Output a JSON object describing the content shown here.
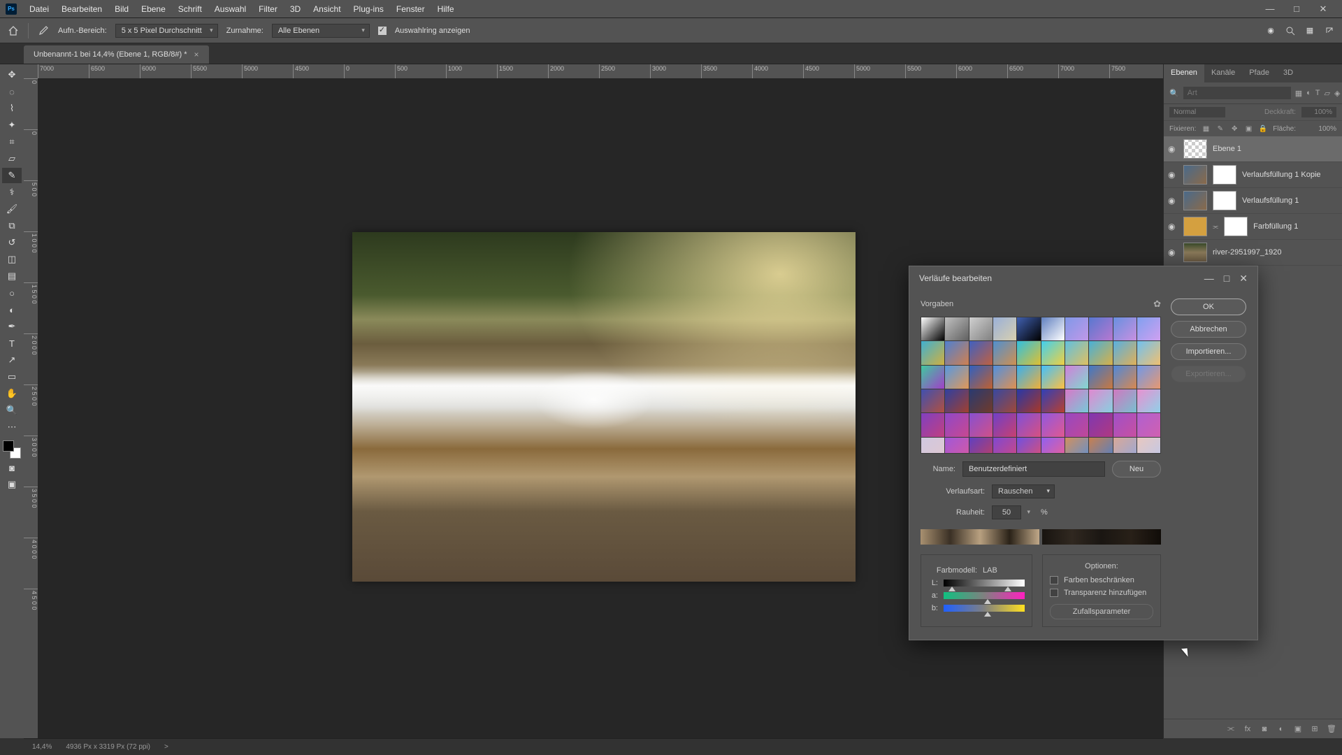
{
  "app_logo": "Ps",
  "menubar": [
    "Datei",
    "Bearbeiten",
    "Bild",
    "Ebene",
    "Schrift",
    "Auswahl",
    "Filter",
    "3D",
    "Ansicht",
    "Plug-ins",
    "Fenster",
    "Hilfe"
  ],
  "optbar": {
    "sample_label": "Aufn.-Bereich:",
    "sample_value": "5 x 5 Pixel Durchschnitt",
    "layers_label": "Zurnahme:",
    "layers_value": "Alle Ebenen",
    "checkbox_label": "Auswahlring anzeigen"
  },
  "tab": {
    "title": "Unbenannt-1 bei 14,4% (Ebene 1, RGB/8#) *",
    "close": "×"
  },
  "ruler_h": [
    "7000",
    "6500",
    "6000",
    "5500",
    "5000",
    "4500",
    "0",
    "500",
    "1000",
    "1500",
    "2000",
    "2500",
    "3000",
    "3500",
    "4000",
    "4500",
    "5000",
    "5500",
    "6000",
    "6500",
    "7000",
    "7500"
  ],
  "ruler_v": [
    "0",
    "0",
    "5 0 0",
    "1 0 0 0",
    "1 5 0 0",
    "2 0 0 0",
    "2 5 0 0",
    "3 0 0 0",
    "3 5 0 0",
    "4 0 0 0",
    "4 5 0 0"
  ],
  "panels": {
    "tabs": [
      "Ebenen",
      "Kanäle",
      "Pfade",
      "3D"
    ],
    "search_placeholder": "Art",
    "blend_mode": "Normal",
    "opacity_label": "Deckkraft:",
    "opacity_value": "100%",
    "lock_label": "Fixieren:",
    "fill_label": "Fläche:",
    "fill_value": "100%"
  },
  "layers": [
    {
      "name": "Ebene 1",
      "thumb": "checker",
      "selected": true
    },
    {
      "name": "Verlaufsfüllung 1 Kopie",
      "thumb": "grad",
      "mask": true
    },
    {
      "name": "Verlaufsfüllung 1",
      "thumb": "grad",
      "mask": true
    },
    {
      "name": "Farbfüllung 1",
      "thumb": "solid",
      "mask": true,
      "linked": true
    },
    {
      "name": "river-2951997_1920",
      "thumb": "img"
    }
  ],
  "statusbar": {
    "zoom": "14,4%",
    "docinfo": "4936 Px x 3319 Px (72 ppi)",
    "arrow": ">"
  },
  "dialog": {
    "title": "Verläufe bearbeiten",
    "win_min": "—",
    "win_max": "□",
    "win_close": "✕",
    "presets_label": "Vorgaben",
    "gear": "✿",
    "ok": "OK",
    "cancel": "Abbrechen",
    "import": "Importieren...",
    "export": "Exportieren...",
    "name_label": "Name:",
    "name_value": "Benutzerdefiniert",
    "new_btn": "Neu",
    "type_label": "Verlaufsart:",
    "type_value": "Rauschen",
    "rough_label": "Rauheit:",
    "rough_value": "50",
    "rough_unit": "%",
    "model_label": "Farbmodell:",
    "model_value": "LAB",
    "ch_L": "L:",
    "ch_a": "a:",
    "ch_b": "b:",
    "options_label": "Optionen:",
    "opt1": "Farben beschränken",
    "opt2": "Transparenz hinzufügen",
    "random_btn": "Zufallsparameter"
  },
  "preset_colors": [
    [
      "#ffffff",
      "#000000"
    ],
    [
      "#c0c0c0",
      "#606060"
    ],
    [
      "#d0d0d0",
      "#808080"
    ],
    [
      "#9ab0d8",
      "#d8d0b0"
    ],
    [
      "#4060b0",
      "#000000"
    ],
    [
      "#6080c0",
      "#ffffff"
    ],
    [
      "#8098e8",
      "#c098e8"
    ],
    [
      "#5878d0",
      "#b878d0"
    ],
    [
      "#6890e0",
      "#c890e0"
    ],
    [
      "#80a0f0",
      "#d0a0f0"
    ],
    [
      "#40b0d0",
      "#d0b040"
    ],
    [
      "#5080d0",
      "#d08050"
    ],
    [
      "#4060c0",
      "#c06040"
    ],
    [
      "#5090d0",
      "#d09050"
    ],
    [
      "#30c0e0",
      "#e0c030"
    ],
    [
      "#40d0f0",
      "#f0d040"
    ],
    [
      "#60c0e0",
      "#e0c060"
    ],
    [
      "#48b0d8",
      "#d8b048"
    ],
    [
      "#58b0e0",
      "#e0b058"
    ],
    [
      "#70c0f0",
      "#f0c070"
    ],
    [
      "#40c8a0",
      "#a040c8"
    ],
    [
      "#5898e0",
      "#e09858"
    ],
    [
      "#3060c0",
      "#c06030"
    ],
    [
      "#5090e0",
      "#e09050"
    ],
    [
      "#38b0f0",
      "#f0b038"
    ],
    [
      "#40c0ff",
      "#ffc040"
    ],
    [
      "#d080d8",
      "#80d8d0"
    ],
    [
      "#4078c8",
      "#c87840"
    ],
    [
      "#5088d8",
      "#d88850"
    ],
    [
      "#7098e8",
      "#e89870"
    ],
    [
      "#4050b0",
      "#b05040"
    ],
    [
      "#3040a0",
      "#a04030"
    ],
    [
      "#2a3a70",
      "#703a2a"
    ],
    [
      "#3848a0",
      "#a04838"
    ],
    [
      "#2838a8",
      "#a83828"
    ],
    [
      "#3040b8",
      "#b84030"
    ],
    [
      "#d878c8",
      "#78c8d8"
    ],
    [
      "#e088d0",
      "#88d0e0"
    ],
    [
      "#d078c0",
      "#78c0d0"
    ],
    [
      "#e890d0",
      "#90d0e8"
    ],
    [
      "#8040c0",
      "#c04080"
    ],
    [
      "#9048c8",
      "#c84890"
    ],
    [
      "#8850d0",
      "#d05088"
    ],
    [
      "#7040c8",
      "#c84070"
    ],
    [
      "#8050d8",
      "#d85080"
    ],
    [
      "#9058e0",
      "#e05890"
    ],
    [
      "#9848c0",
      "#c04898"
    ],
    [
      "#8038b0",
      "#b03880"
    ],
    [
      "#a050c8",
      "#c850a0"
    ],
    [
      "#b060d0",
      "#d060b0"
    ],
    [
      "#d0c8e0",
      "#e0c8d0"
    ],
    [
      "#a058d8",
      "#d858a0"
    ],
    [
      "#6040c0",
      "#c04060"
    ],
    [
      "#8048d0",
      "#d04880"
    ],
    [
      "#7050e0",
      "#e05070"
    ],
    [
      "#9060f0",
      "#f06090"
    ],
    [
      "#d09060",
      "#6090d0"
    ],
    [
      "#c88050",
      "#5080c8"
    ],
    [
      "#d8a898",
      "#98a8d8"
    ],
    [
      "#e8c8c0",
      "#c0c8e8"
    ]
  ],
  "chart_data": null
}
